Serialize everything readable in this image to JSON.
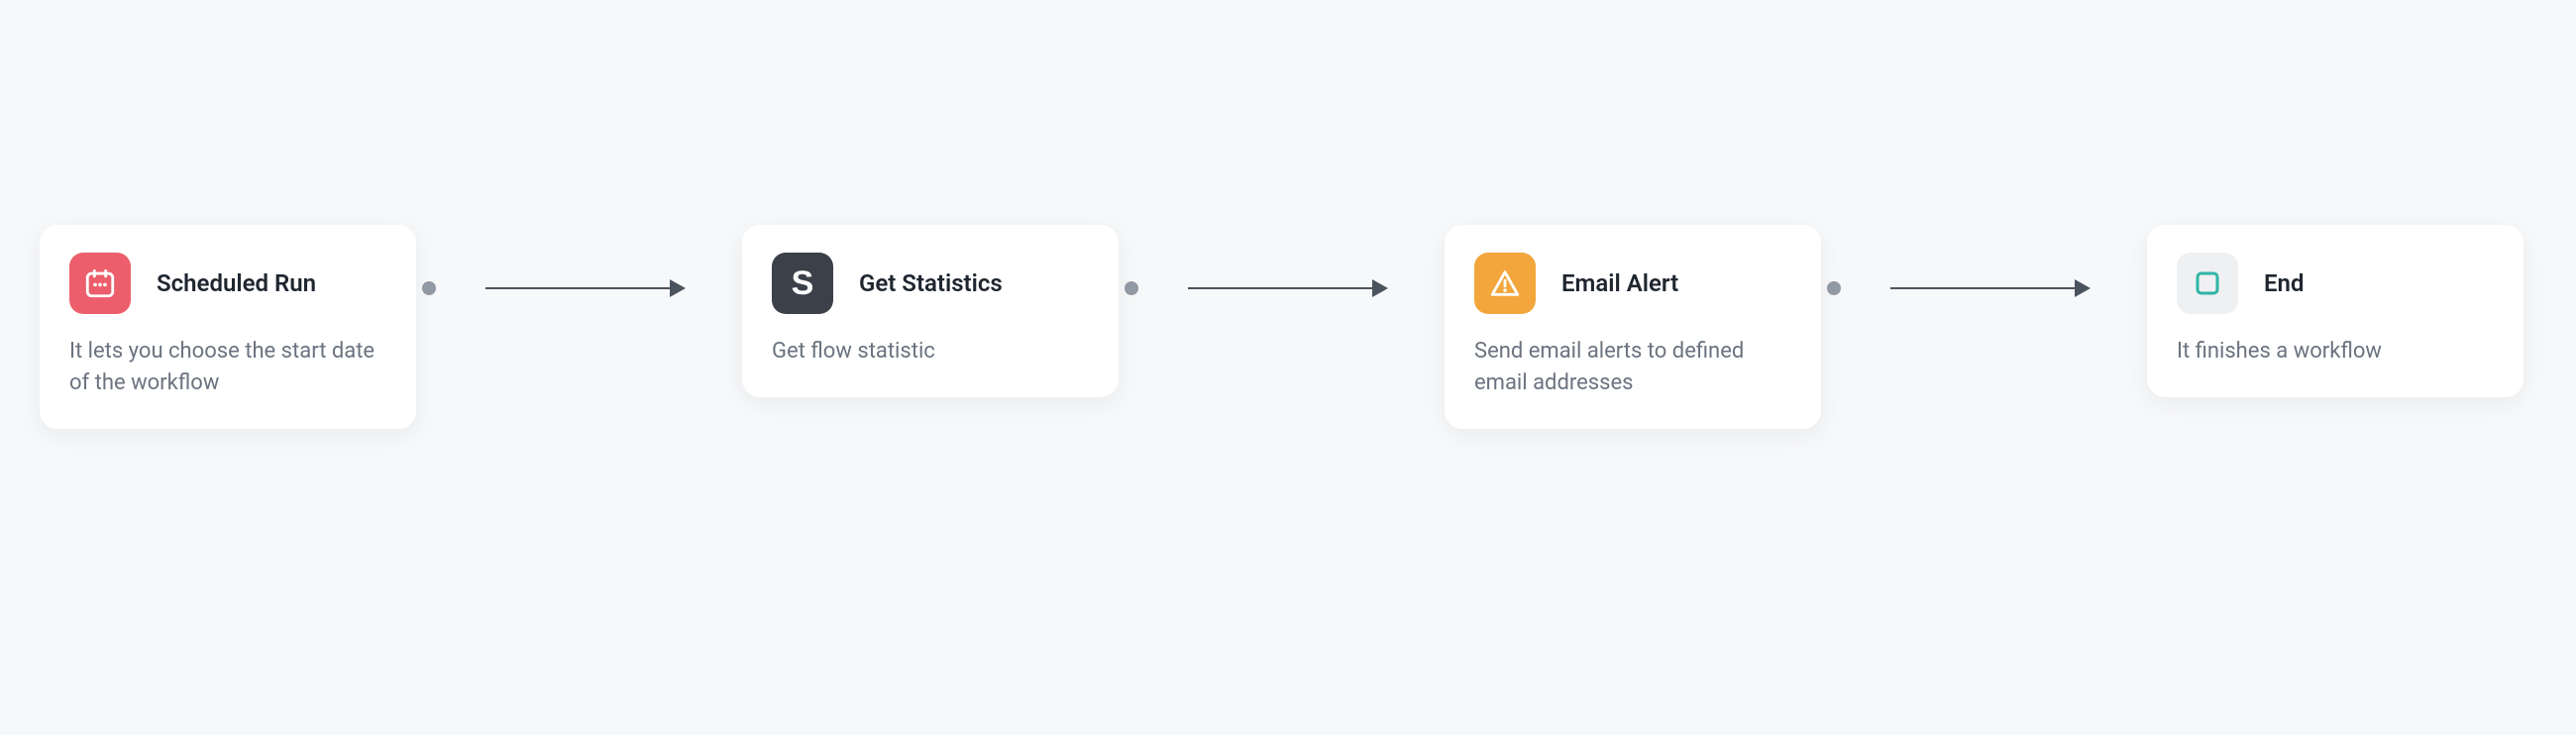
{
  "nodes": [
    {
      "id": "scheduled-run",
      "title": "Scheduled Run",
      "description": "It lets you choose the start date of the workflow",
      "icon": "calendar-icon",
      "icon_color": "#ec5e6b"
    },
    {
      "id": "get-statistics",
      "title": "Get Statistics",
      "description": "Get flow statistic",
      "icon": "s-letter-icon",
      "icon_color": "#3b4049"
    },
    {
      "id": "email-alert",
      "title": "Email Alert",
      "description": "Send email alerts to defined email addresses",
      "icon": "warning-icon",
      "icon_color": "#f2a63b"
    },
    {
      "id": "end",
      "title": "End",
      "description": "It finishes a workflow",
      "icon": "square-icon",
      "icon_color": "#eef0f2"
    }
  ],
  "connections": [
    {
      "from": "scheduled-run",
      "to": "get-statistics"
    },
    {
      "from": "get-statistics",
      "to": "email-alert"
    },
    {
      "from": "email-alert",
      "to": "end"
    }
  ]
}
